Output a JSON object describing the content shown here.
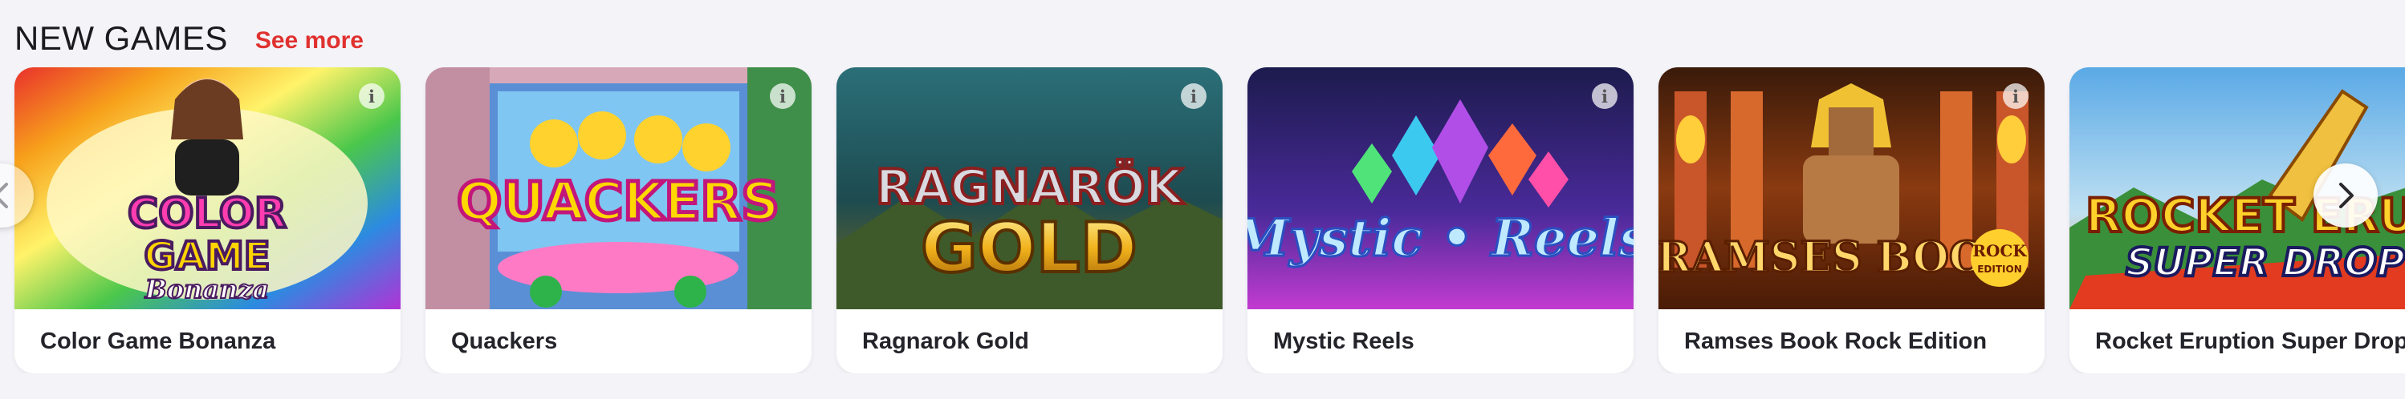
{
  "section": {
    "title": "NEW GAMES",
    "see_more": "See more"
  },
  "games": [
    {
      "name": "Color Game Bonanza",
      "art_line1": "COLOR",
      "art_line2": "GAME",
      "art_line3": "Bonanza"
    },
    {
      "name": "Quackers",
      "art_line1": "QUACKERS"
    },
    {
      "name": "Ragnarok Gold",
      "art_line1": "RAGNARÖK",
      "art_line2": "GOLD"
    },
    {
      "name": "Mystic Reels",
      "art_line1": "Mystic",
      "art_line2": "Reels"
    },
    {
      "name": "Ramses Book Rock Edition",
      "art_line1": "RAMSES BOOK",
      "art_line2": "ROCK",
      "art_line3": "EDITION"
    },
    {
      "name": "Rocket Eruption Super Drop",
      "art_line1": "ROCKET ERUPTIO",
      "art_line2": "SUPER DROP"
    }
  ],
  "icons": {
    "info": "i",
    "prev": "chevron-left-icon",
    "next": "chevron-right-icon"
  }
}
